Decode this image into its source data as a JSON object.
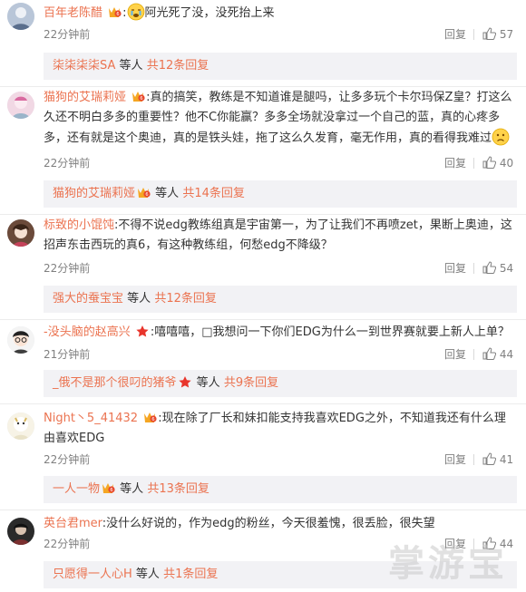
{
  "ui": {
    "reply_label": "回复",
    "others_text": "等人",
    "watermark": "掌游宝"
  },
  "comments": [
    {
      "username": "百年老陈醋",
      "text": "阿光死了没，没死抬上来",
      "time": "22分钟前",
      "likes": "57",
      "sub_user": "柒柒柒柒SA",
      "sub_total": "共12条回复"
    },
    {
      "username": "猫狗的艾瑞莉娅",
      "text": "真的搞笑，教练是不知道谁是腿吗，让多多玩个卡尔玛保Z皇？打这么久还不明白多多的重要性？他不C你能赢？多多全场就没拿过一个自己的蓝，真的心疼多多，还有就是这个奥迪，真的是铁头娃，拖了这么久发育，毫无作用，真的看得我难过",
      "time": "22分钟前",
      "likes": "40",
      "sub_user": "猫狗的艾瑞莉娅",
      "sub_total": "共14条回复"
    },
    {
      "username": "标致的小馄饨",
      "text": "不得不说edg教练组真是宇宙第一，为了让我们不再喷zet，果断上奥迪，这招声东击西玩的真6，有这种教练组，何愁edg不降级？",
      "time": "22分钟前",
      "likes": "54",
      "sub_user": "强大的蚕宝宝",
      "sub_total": "共12条回复"
    },
    {
      "username": "-没头脑的赵高兴",
      "text": "嘻嘻嘻，□我想问一下你们EDG为什么一到世界赛就要上新人上单？",
      "time": "21分钟前",
      "likes": "44",
      "sub_user": "_俄不是那个很叼的猪爷",
      "sub_total": "共9条回复"
    },
    {
      "username": "Night丶5_41432",
      "text": "现在除了厂长和妹扣能支持我喜欢EDG之外，不知道我还有什么理由喜欢EDG",
      "time": "22分钟前",
      "likes": "41",
      "sub_user": "一人一物",
      "sub_total": "共13条回复"
    },
    {
      "username": "英台君mer",
      "text": "没什么好说的，作为edg的粉丝，今天很羞愧，很丢脸，很失望",
      "time": "22分钟前",
      "likes": "44",
      "sub_user": "只愿得一人心H",
      "sub_total": "共1条回复"
    }
  ],
  "colors": {
    "username": "#eb7350",
    "subbox_bg": "#f2f2f5",
    "meta": "#808080"
  },
  "icons": [
    "vip-badge-icon",
    "star-badge-icon",
    "like-thumb-icon",
    "crying-emoji-icon",
    "sad-emoji-icon"
  ]
}
